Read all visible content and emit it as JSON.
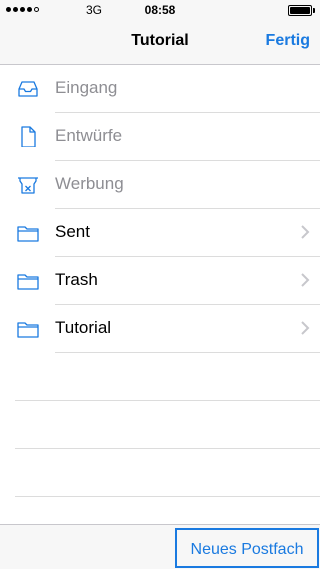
{
  "status_bar": {
    "carrier": "3G",
    "time": "08:58"
  },
  "navbar": {
    "title": "Tutorial",
    "done_label": "Fertig"
  },
  "mailboxes": [
    {
      "label": "Eingang",
      "icon": "inbox-icon",
      "enabled": false
    },
    {
      "label": "Entwürfe",
      "icon": "document-icon",
      "enabled": false
    },
    {
      "label": "Werbung",
      "icon": "junk-icon",
      "enabled": false
    },
    {
      "label": "Sent",
      "icon": "folder-icon",
      "enabled": true
    },
    {
      "label": "Trash",
      "icon": "folder-icon",
      "enabled": true
    },
    {
      "label": "Tutorial",
      "icon": "folder-icon",
      "enabled": true
    }
  ],
  "toolbar": {
    "new_mailbox_label": "Neues Postfach"
  },
  "colors": {
    "accent": "#1a7ae0",
    "disabled_text": "#8e8e93"
  }
}
